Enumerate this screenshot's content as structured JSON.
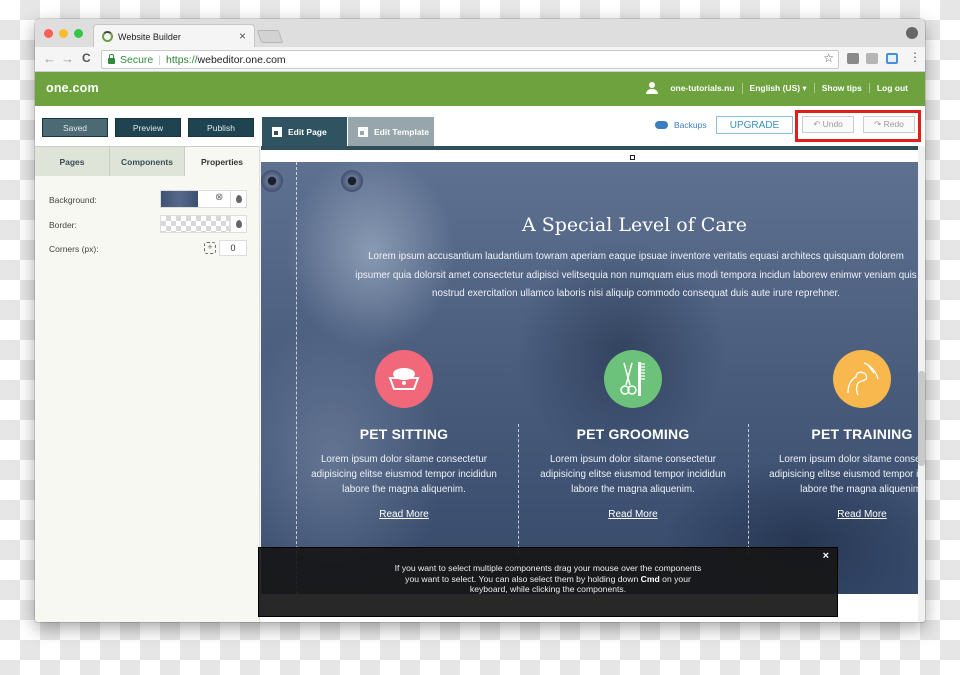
{
  "browser": {
    "tab_title": "Website Builder",
    "tab_close": "×",
    "nav_back": "←",
    "nav_forward": "→",
    "nav_reload": "C",
    "secure_label": "Secure",
    "url_scheme": "https://",
    "url_host": "webeditor.one.com",
    "bookmark_star": "☆",
    "menu": "⋮"
  },
  "header": {
    "logo": "one.com",
    "account": "one-tutorials.nu",
    "language": "English (US) ▾",
    "show_tips": "Show tips",
    "logout": "Log out",
    "brand_color": "#6ea23f"
  },
  "toolbar": {
    "saved": "Saved",
    "preview": "Preview",
    "publish": "Publish",
    "edit_page": "Edit Page",
    "edit_template": "Edit Template",
    "backups": "Backups",
    "upgrade": "UPGRADE",
    "undo": "↶ Undo",
    "redo": "↷ Redo",
    "highlight_color": "#e31c1c"
  },
  "left_panel": {
    "tabs": [
      {
        "label": "Pages",
        "active": false
      },
      {
        "label": "Components",
        "active": false
      },
      {
        "label": "Properties",
        "active": true
      }
    ],
    "properties": {
      "background_label": "Background:",
      "border_label": "Border:",
      "corners_label": "Corners (px):",
      "corners_value": "0",
      "clear_icon": "⊗"
    }
  },
  "canvas": {
    "title": "A Special Level of Care",
    "body": "Lorem ipsum accusantium laudantium towram aperiam eaque ipsuae inventore veritatis equasi architecs quisquam dolorem ipsumer quia dolorsit amet consectetur adipisci velitsequia non numquam eius modi tempora incidun laborew enimwr veniam quis nostrud exercitation ullamco laboris nisi aliquip commodo consequat duis aute irure reprehner.",
    "features": [
      {
        "icon": "pet-bowl",
        "color": "#f0687a",
        "title": "PET SITTING",
        "text": "Lorem ipsum dolor sitame consectetur\nadipisicing elitse eiusmod tempor incididun\nlabore the magna aliquenim.",
        "link": "Read More"
      },
      {
        "icon": "scissors-comb",
        "color": "#6cc27a",
        "title": "PET GROOMING",
        "text": "Lorem ipsum dolor sitame consectetur\nadipisicing elitse eiusmod tempor incididun\nlabore the magna aliquenim.",
        "link": "Read More"
      },
      {
        "icon": "dog-hand",
        "color": "#f8b84e",
        "title": "PET TRAINING",
        "text": "Lorem ipsum dolor sitame consectetur\nadipisicing elitse eiusmod tempor incididun\nlabore the magna aliquenim.",
        "link": "Read More"
      }
    ]
  },
  "hint": {
    "text_before": "If you want to select multiple components drag your mouse over the components you want to select. You can also select them by holding down ",
    "key": "Cmd",
    "text_after": " on your keyboard, while clicking the components.",
    "close": "×"
  }
}
